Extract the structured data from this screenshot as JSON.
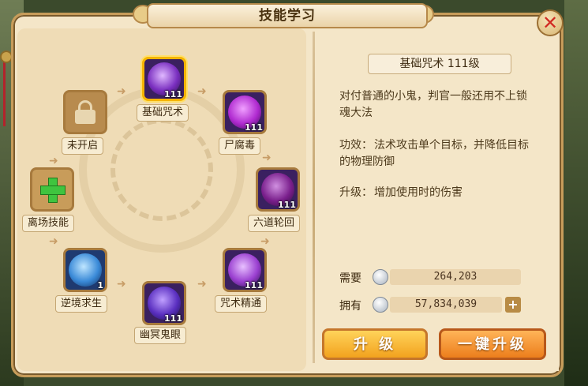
{
  "window": {
    "title": "技能学习",
    "close_icon": "close-icon"
  },
  "skills": [
    {
      "name": "基础咒术",
      "level": "111",
      "selected": true,
      "icon": "purple-ghost-orb-icon"
    },
    {
      "name": "尸腐毒",
      "level": "111",
      "icon": "poison-ghost-icon"
    },
    {
      "name": "六道轮回",
      "level": "111",
      "icon": "skull-orb-icon"
    },
    {
      "name": "咒术精通",
      "level": "111",
      "icon": "purple-flame-orb-icon"
    },
    {
      "name": "幽冥鬼眼",
      "level": "111",
      "icon": "ghost-eye-orb-icon"
    },
    {
      "name": "逆境求生",
      "level": "1",
      "icon": "blue-spirit-orb-icon"
    },
    {
      "name": "离场技能",
      "level": "",
      "icon": "green-plus-icon"
    },
    {
      "name": "未开启",
      "level": "",
      "icon": "lock-icon"
    }
  ],
  "detail": {
    "header": "基础咒术 111级",
    "description": "对付普通的小鬼，判官一般还用不上锁魂大法",
    "effect_label": "功效：",
    "effect_text": "法术攻击单个目标，并降低目标的物理防御",
    "upgrade_label": "升级：",
    "upgrade_text": "增加使用时的伤害"
  },
  "resources": {
    "need_label": "需要",
    "need_value": "264,203",
    "own_label": "拥有",
    "own_value": "57,834,039",
    "plus_label": "+",
    "coin_icon": "silver-coin-icon"
  },
  "buttons": {
    "upgrade": "升 级",
    "upgrade_all": "一键升级"
  },
  "colors": {
    "accent_gold": "#f5b400",
    "close_red": "#d12a22",
    "button_orange": "#ec7e1c"
  }
}
